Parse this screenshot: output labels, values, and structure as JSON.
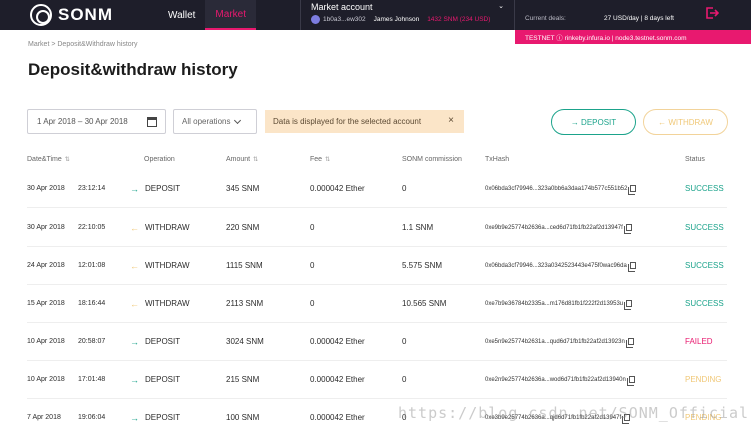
{
  "header": {
    "logo_text": "SONM",
    "nav": [
      {
        "label": "Wallet",
        "active": false
      },
      {
        "label": "Market",
        "active": true
      }
    ],
    "account": {
      "title": "Market account",
      "address": "1b0a3...ew302",
      "name": "James Johnson",
      "balance": "1432 SNM (234 USD)"
    },
    "deals_label": "Current deals:",
    "deals_value": "27 USD/day  |  8 days left",
    "testnet": "TESTNET ⓘ     rinkeby.infura.io  |  node3.testnet.sonm.com"
  },
  "breadcrumb": "Market  >  Deposit&Withdraw history",
  "page_title": "Deposit&withdraw history",
  "filters": {
    "date_range": "1 Apr 2018 – 30 Apr 2018",
    "operations": "All operations",
    "notice": "Data is displayed for the selected account"
  },
  "buttons": {
    "deposit": "→  DEPOSIT",
    "withdraw": "←  WITHDRAW"
  },
  "colors": {
    "accent": "#e8196f",
    "success": "#1ba38b",
    "failed": "#e8196f",
    "pending": "#f0c878"
  },
  "table": {
    "headers": {
      "datetime": "Date&Time",
      "operation": "Operation",
      "amount": "Amount",
      "fee": "Fee",
      "commission": "SONM commission",
      "txhash": "TxHash",
      "status": "Status"
    },
    "rows": [
      {
        "date": "30 Apr 2018",
        "time": "23:12:14",
        "op": "DEPOSIT",
        "amount": "345 SNM",
        "fee": "0.000042 Ether",
        "commission": "0",
        "hash": "0x06bda3cf79946...323a0bb6a3daa174b577c551b52",
        "status": "SUCCESS"
      },
      {
        "date": "30 Apr 2018",
        "time": "22:10:05",
        "op": "WITHDRAW",
        "amount": "220 SNM",
        "fee": "0",
        "commission": "1.1 SNM",
        "hash": "0xe9b9e25774b2636a...ced6d71fb1fb22af2d13947f",
        "status": "SUCCESS"
      },
      {
        "date": "24 Apr 2018",
        "time": "12:01:08",
        "op": "WITHDRAW",
        "amount": "1115 SNM",
        "fee": "0",
        "commission": "5.575 SNM",
        "hash": "0x06bda3cf79946...323a0342523443e475f0wac96da",
        "status": "SUCCESS"
      },
      {
        "date": "15 Apr 2018",
        "time": "18:16:44",
        "op": "WITHDRAW",
        "amount": "2113 SNM",
        "fee": "0",
        "commission": "10.565 SNM",
        "hash": "0xe7b9e36784b2335a...m176d81fb1f222f2d13953u",
        "status": "SUCCESS"
      },
      {
        "date": "10 Apr 2018",
        "time": "20:58:07",
        "op": "DEPOSIT",
        "amount": "3024 SNM",
        "fee": "0.000042 Ether",
        "commission": "0",
        "hash": "0xe5n9e25774b2631a...qud6d71fb1fb22af2d13923n",
        "status": "FAILED"
      },
      {
        "date": "10 Apr 2018",
        "time": "17:01:48",
        "op": "DEPOSIT",
        "amount": "215 SNM",
        "fee": "0.000042 Ether",
        "commission": "0",
        "hash": "0xe2n9e25774b2636a...wod6d71fb1fb22af2d13940n",
        "status": "PENDING"
      },
      {
        "date": "7 Apr 2018",
        "time": "19:06:04",
        "op": "DEPOSIT",
        "amount": "100 SNM",
        "fee": "0.000042 Ether",
        "commission": "0",
        "hash": "0xe3b9e25774b2636a...qjd6d71fb1fb22af2d13947f",
        "status": "PENDING"
      }
    ]
  },
  "watermark": "https://blog.csdn.net/SONM_Official"
}
